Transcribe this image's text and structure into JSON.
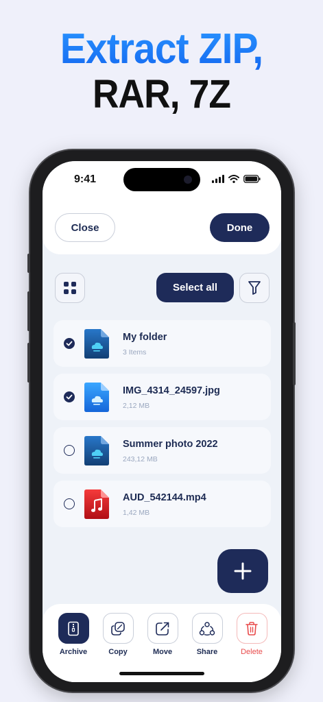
{
  "headline": {
    "line1": "Extract ZIP,",
    "line2": "RAR, 7Z"
  },
  "status": {
    "time": "9:41",
    "icons": [
      "signal-icon",
      "wifi-icon",
      "battery-icon"
    ]
  },
  "header": {
    "close_label": "Close",
    "done_label": "Done"
  },
  "toolbar": {
    "grid_icon": "grid-icon",
    "select_all_label": "Select all",
    "filter_icon": "filter-icon"
  },
  "files": [
    {
      "name": "My folder",
      "meta": "3 Items",
      "checked": true,
      "icon": "folder-cloud-icon"
    },
    {
      "name": "IMG_4314_24597.jpg",
      "meta": "2,12  MB",
      "checked": true,
      "icon": "image-file-icon"
    },
    {
      "name": "Summer photo 2022",
      "meta": "243,12  MB",
      "checked": false,
      "icon": "folder-cloud-icon"
    },
    {
      "name": "AUD_542144.mp4",
      "meta": "1,42  MB",
      "checked": false,
      "icon": "audio-file-icon"
    }
  ],
  "fab": {
    "icon": "plus-icon"
  },
  "bottom_actions": [
    {
      "label": "Archive",
      "icon": "archive-icon",
      "active": true
    },
    {
      "label": "Copy",
      "icon": "copy-icon"
    },
    {
      "label": "Move",
      "icon": "move-icon"
    },
    {
      "label": "Share",
      "icon": "share-icon"
    },
    {
      "label": "Delete",
      "icon": "trash-icon",
      "danger": true
    }
  ],
  "colors": {
    "navy": "#1e2b59",
    "headline_blue": "#1f7cf6",
    "delete_red": "#e84a4a",
    "background": "#eff0fa"
  }
}
